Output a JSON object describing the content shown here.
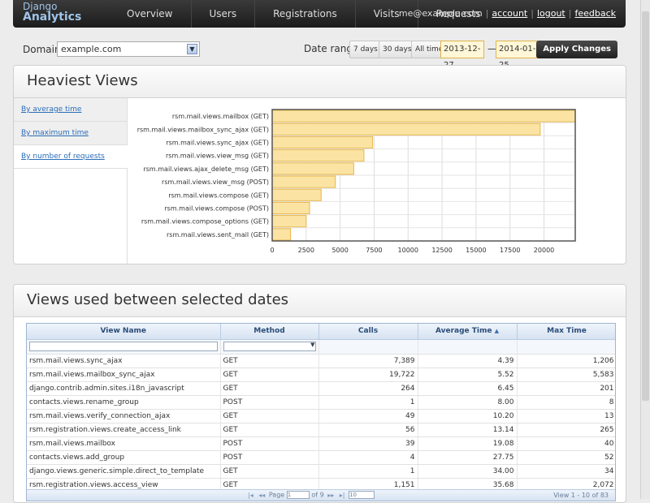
{
  "brand": {
    "line1": "Django",
    "line2": "Analytics"
  },
  "nav": [
    {
      "label": "Overview"
    },
    {
      "label": "Users"
    },
    {
      "label": "Registrations"
    },
    {
      "label": "Visits"
    },
    {
      "label": "Requests"
    }
  ],
  "user": {
    "email": "me@example.com",
    "account": "account",
    "logout": "logout",
    "feedback": "feedback"
  },
  "filters": {
    "domain_label": "Domain:",
    "domain_value": "example.com",
    "date_range_label": "Date range:",
    "range_buttons": [
      "7 days",
      "30 days",
      "All time"
    ],
    "date_from": "2013-12-27",
    "date_sep": "—",
    "date_to": "2014-01-25",
    "apply_label": "Apply Changes"
  },
  "heaviest": {
    "title": "Heaviest Views",
    "tabs": [
      "By average time",
      "By maximum time",
      "By number of requests"
    ],
    "active_tab": 2
  },
  "chart_data": {
    "type": "bar",
    "orientation": "horizontal",
    "categories": [
      "rsm.mail.views.mailbox (GET)",
      "rsm.mail.views.mailbox_sync_ajax (GET)",
      "rsm.mail.views.sync_ajax (GET)",
      "rsm.mail.views.view_msg (GET)",
      "rsm.mail.views.ajax_delete_msg (GET)",
      "rsm.mail.views.view_msg (POST)",
      "rsm.mail.views.compose (GET)",
      "rsm.mail.views.compose (POST)",
      "rsm.mail.views.compose_options (GET)",
      "rsm.mail.views.sent_mail (GET)"
    ],
    "values": [
      22300,
      19722,
      7389,
      6750,
      6000,
      4650,
      3600,
      2750,
      2500,
      1350
    ],
    "xlim": [
      0,
      22300
    ],
    "xticks": [
      "0",
      "2500",
      "5000",
      "7500",
      "10000",
      "12500",
      "15000",
      "17500",
      "20000"
    ],
    "grid": true,
    "colors": {
      "bar_fill": "#fbe4a3",
      "bar_stroke": "#e8b64a"
    }
  },
  "views_table": {
    "title": "Views used between selected dates",
    "columns": [
      "View Name",
      "Method",
      "Calls",
      "Average Time",
      "Max Time"
    ],
    "rows": [
      [
        "rsm.mail.views.sync_ajax",
        "GET",
        "7,389",
        "4.39",
        "1,206"
      ],
      [
        "rsm.mail.views.mailbox_sync_ajax",
        "GET",
        "19,722",
        "5.52",
        "5,583"
      ],
      [
        "django.contrib.admin.sites.i18n_javascript",
        "GET",
        "264",
        "6.45",
        "201"
      ],
      [
        "contacts.views.rename_group",
        "POST",
        "1",
        "8.00",
        "8"
      ],
      [
        "rsm.mail.views.verify_connection_ajax",
        "GET",
        "49",
        "10.20",
        "13"
      ],
      [
        "rsm.registration.views.create_access_link",
        "GET",
        "56",
        "13.14",
        "265"
      ],
      [
        "rsm.mail.views.mailbox",
        "POST",
        "39",
        "19.08",
        "40"
      ],
      [
        "contacts.views.add_group",
        "POST",
        "4",
        "27.75",
        "52"
      ],
      [
        "django.views.generic.simple.direct_to_template",
        "GET",
        "1",
        "34.00",
        "34"
      ],
      [
        "rsm.registration.views.access_view",
        "GET",
        "1,151",
        "35.68",
        "2,072"
      ]
    ],
    "pager": {
      "page_label": "Page",
      "page_value": "1",
      "of_label": "of 9",
      "page_size": "10",
      "view_info": "View 1 - 10 of 83"
    }
  }
}
